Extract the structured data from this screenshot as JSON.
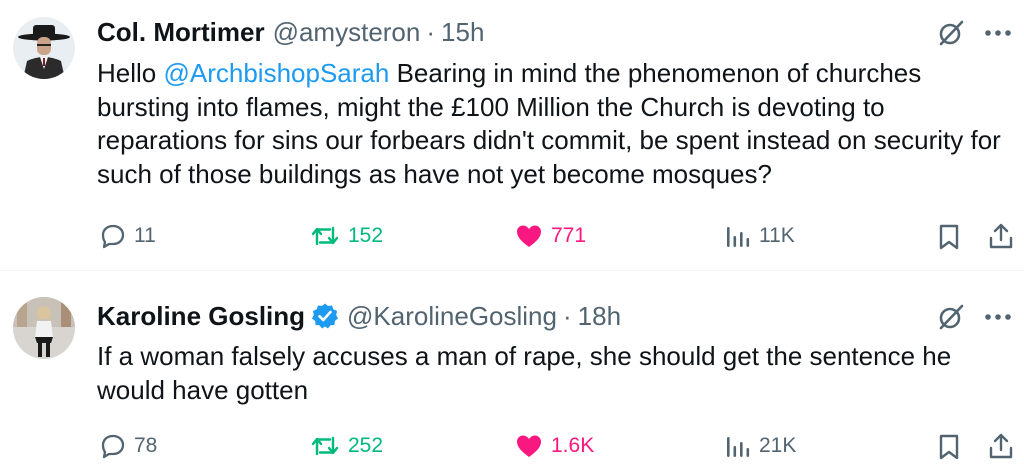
{
  "tweets": [
    {
      "name": "Col. Mortimer",
      "handle": "@amysteron",
      "sep": "·",
      "time": "15h",
      "verified": false,
      "text_before": "Hello ",
      "mention": "@ArchbishopSarah",
      "text_after": " Bearing in mind the phenomenon of churches bursting into flames, might the £100 Million the Church is devoting to reparations for sins our forbears didn't commit, be spent instead on security for such of those buildings as have not yet become mosques?",
      "replies": "11",
      "reposts": "152",
      "likes": "771",
      "views": "11K",
      "liked": true,
      "reposted": true
    },
    {
      "name": "Karoline Gosling",
      "handle": "@KarolineGosling",
      "sep": "·",
      "time": "18h",
      "verified": true,
      "text": "If a woman falsely accuses a man of rape, she should get the sentence he would have gotten",
      "replies": "78",
      "reposts": "252",
      "likes": "1.6K",
      "views": "21K",
      "liked": true,
      "reposted": true
    }
  ],
  "icons": {
    "reply": "reply-icon",
    "repost": "repost-icon",
    "like": "heart-icon",
    "views": "views-icon",
    "bookmark": "bookmark-icon",
    "share": "share-icon",
    "grok": "grok-icon",
    "more": "more-icon",
    "verified": "verified-badge-icon"
  },
  "colors": {
    "text": "#0f1419",
    "secondary": "#536471",
    "link": "#1d9bf0",
    "repost": "#00ba7c",
    "like": "#f91880",
    "divider": "#eff3f4"
  }
}
